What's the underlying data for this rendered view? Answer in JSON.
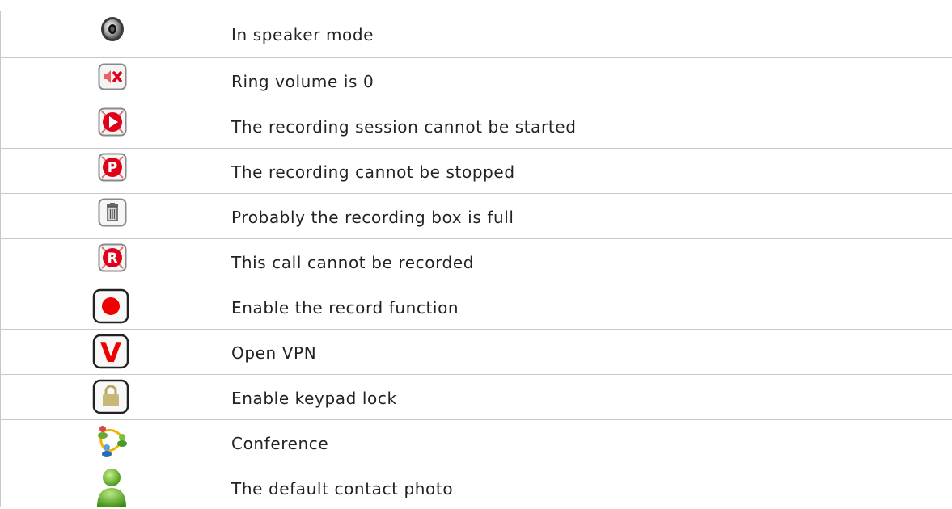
{
  "rows": [
    {
      "icon": "speaker-icon",
      "label": "In speaker mode"
    },
    {
      "icon": "ring-volume-muted-icon",
      "label": "Ring volume is 0"
    },
    {
      "icon": "record-start-failed-icon",
      "label": "The recording session cannot be started"
    },
    {
      "icon": "record-stop-failed-icon",
      "label": "The recording cannot be stopped"
    },
    {
      "icon": "trash-icon",
      "label": "Probably the recording box is full"
    },
    {
      "icon": "record-disabled-icon",
      "label": "This call cannot be recorded"
    },
    {
      "icon": "record-button-icon",
      "label": "Enable the record function"
    },
    {
      "icon": "vpn-icon",
      "label": "Open VPN"
    },
    {
      "icon": "keypad-lock-icon",
      "label": "Enable keypad lock"
    },
    {
      "icon": "conference-icon",
      "label": "Conference"
    },
    {
      "icon": "default-contact-photo-icon",
      "label": "The default contact photo"
    }
  ],
  "colors": {
    "grid": "#c8c8c8",
    "alert_red": "#e0001a",
    "record_red": "#ee0000",
    "lock_gold": "#c8b878",
    "contact_green": "#5fb820"
  }
}
